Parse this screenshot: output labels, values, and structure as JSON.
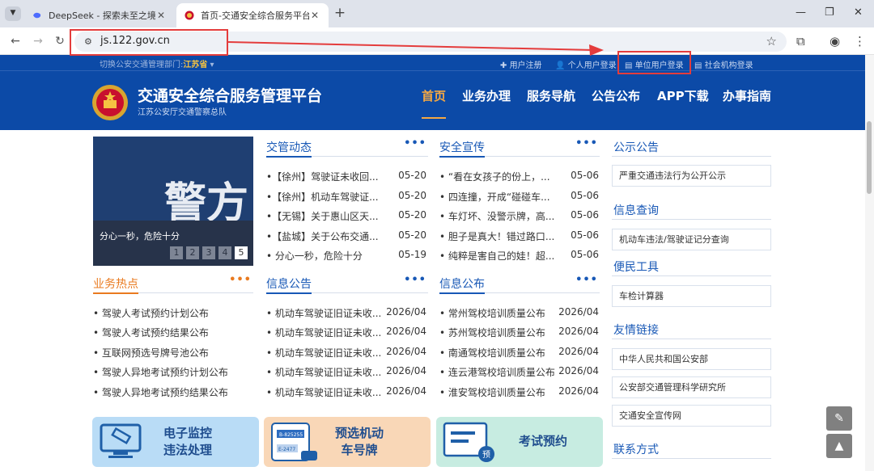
{
  "browser": {
    "tabs": [
      {
        "title": "DeepSeek - 探索未至之境",
        "active": false,
        "icon": "deepseek-whale-icon"
      },
      {
        "title": "首页-交通安全综合服务平台",
        "active": true,
        "icon": "police-emblem-icon"
      }
    ],
    "url": "js.122.gov.cn"
  },
  "header": {
    "dept_prefix": "切换公安交通管理部门:",
    "dept_name": "江苏省",
    "top_links": [
      "用户注册",
      "个人用户登录",
      "单位用户登录",
      "社会机构登录"
    ],
    "site_title": "交通安全综合服务管理平台",
    "site_subtitle": "江苏公安厅交通警察总队",
    "nav": [
      "首页",
      "业务办理",
      "服务导航",
      "公告公布",
      "APP下载",
      "办事指南"
    ]
  },
  "banner": {
    "big_text": "警方",
    "caption": "分心一秒，危险十分",
    "pages": [
      "1",
      "2",
      "3",
      "4",
      "5"
    ],
    "active_page": "5"
  },
  "sections": {
    "jiaoguan": {
      "title": "交管动态",
      "items": [
        {
          "text": "•【徐州】驾驶证未收回...",
          "date": "05-20"
        },
        {
          "text": "•【徐州】机动车驾驶证...",
          "date": "05-20"
        },
        {
          "text": "•【无锡】关于惠山区天...",
          "date": "05-20"
        },
        {
          "text": "•【盐城】关于公布交通...",
          "date": "05-20"
        },
        {
          "text": "• 分心一秒，危险十分",
          "date": "05-19"
        }
      ]
    },
    "anquan": {
      "title": "安全宣传",
      "items": [
        {
          "text": "• “看在女孩子的份上，...",
          "date": "05-06"
        },
        {
          "text": "• 四连撞，开成“碰碰车...",
          "date": "05-06"
        },
        {
          "text": "• 车灯坏、没警示牌，高...",
          "date": "05-06"
        },
        {
          "text": "• 胆子是真大！错过路口...",
          "date": "05-06"
        },
        {
          "text": "• 纯粹是害自己的娃！超...",
          "date": "05-06"
        }
      ]
    },
    "yewu": {
      "title": "业务热点",
      "items": [
        "• 驾驶人考试预约计划公布",
        "• 驾驶人考试预约结果公布",
        "• 互联网预选号牌号池公布",
        "• 驾驶人异地考试预约计划公布",
        "• 驾驶人异地考试预约结果公布"
      ]
    },
    "xinxi_gonggao": {
      "title": "信息公告",
      "items": [
        {
          "text": "• 机动车驾驶证旧证未收...",
          "date": "2026/04"
        },
        {
          "text": "• 机动车驾驶证旧证未收...",
          "date": "2026/04"
        },
        {
          "text": "• 机动车驾驶证旧证未收...",
          "date": "2026/04"
        },
        {
          "text": "• 机动车驾驶证旧证未收...",
          "date": "2026/04"
        },
        {
          "text": "• 机动车驾驶证旧证未收...",
          "date": "2026/04"
        }
      ]
    },
    "xinxi_gongbu": {
      "title": "信息公布",
      "items": [
        {
          "text": "• 常州驾校培训质量公布",
          "date": "2026/04"
        },
        {
          "text": "• 苏州驾校培训质量公布",
          "date": "2026/04"
        },
        {
          "text": "• 南通驾校培训质量公布",
          "date": "2026/04"
        },
        {
          "text": "• 连云港驾校培训质量公布",
          "date": "2026/04"
        },
        {
          "text": "• 淮安驾校培训质量公布",
          "date": "2026/04"
        }
      ]
    }
  },
  "sidebar": {
    "gongshi_title": "公示公告",
    "gongshi_item": "严重交通违法行为公开公示",
    "chaxun_title": "信息查询",
    "chaxun_item": "机动车违法/驾驶证记分查询",
    "tools_title": "便民工具",
    "tools_item": "车检计算器",
    "links_title": "友情链接",
    "links": [
      "中华人民共和国公安部",
      "公安部交通管理科学研究所",
      "交通安全宣传网"
    ],
    "contact_title": "联系方式"
  },
  "cards": [
    {
      "label1": "电子监控",
      "label2": "违法处理",
      "bg": "#b9dcf6"
    },
    {
      "label1": "预选机动",
      "label2": "车号牌",
      "bg": "#f9d7b7"
    },
    {
      "label1": "考试预约",
      "label2": "",
      "bg": "#c7ece1"
    }
  ],
  "card_art": {
    "plate_top": "B-825255",
    "plate_bottom": "E-2477",
    "badge": "预"
  },
  "colors": {
    "header_blue": "#0c4aa7",
    "accent_orange": "#f5a843",
    "link_blue": "#1858b6",
    "annotation_red": "#e43c3c"
  }
}
